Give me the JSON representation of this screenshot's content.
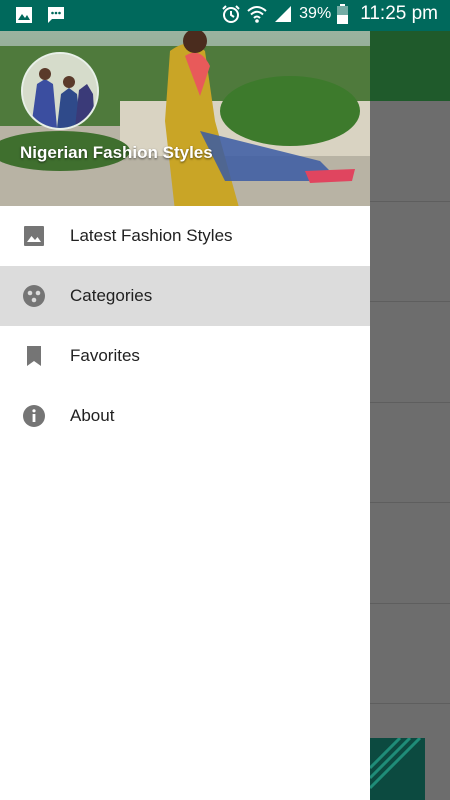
{
  "status_bar": {
    "battery_percent": "39%",
    "time": "11:25 pm"
  },
  "drawer": {
    "title": "Nigerian Fashion Styles",
    "items": [
      {
        "label": "Latest Fashion Styles",
        "icon": "image-icon",
        "selected": false
      },
      {
        "label": "Categories",
        "icon": "categories-icon",
        "selected": true
      },
      {
        "label": "Favorites",
        "icon": "bookmark-icon",
        "selected": false
      },
      {
        "label": "About",
        "icon": "info-icon",
        "selected": false
      }
    ]
  },
  "colors": {
    "status_bar": "#00695c",
    "toolbar": "#1f5a2b",
    "selected_item": "#dcdcdc",
    "icon": "#757575"
  }
}
